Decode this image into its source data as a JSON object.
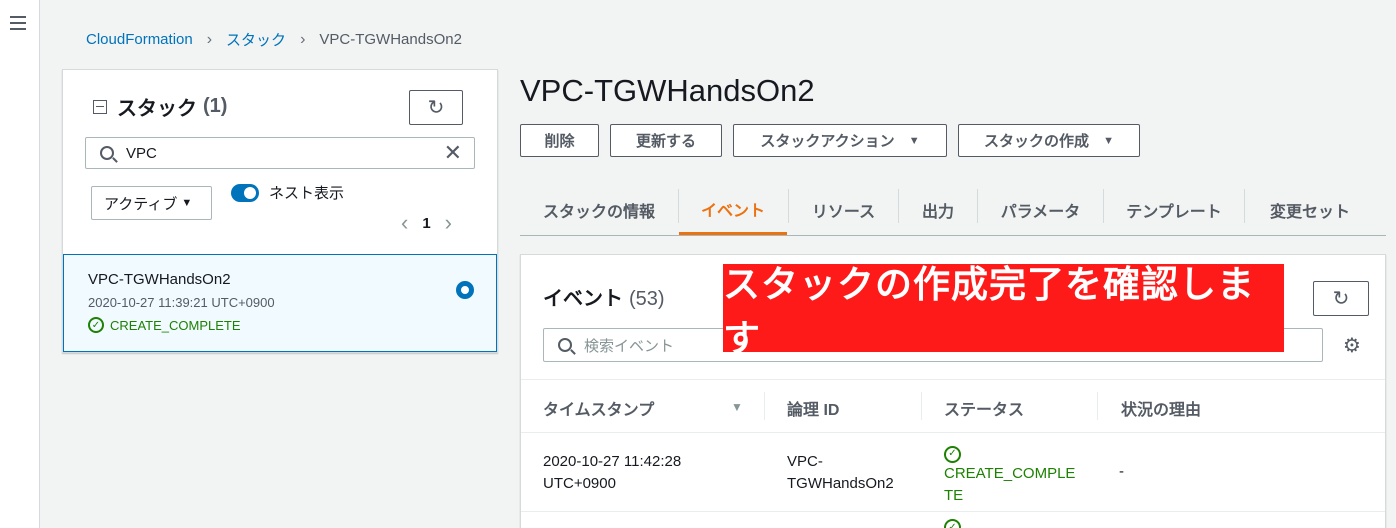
{
  "breadcrumb": {
    "root": "CloudFormation",
    "mid": "スタック",
    "current": "VPC-TGWHandsOn2"
  },
  "stack_panel": {
    "title": "スタック",
    "count": "(1)",
    "search_value": "VPC",
    "filter_label": "アクティブ",
    "nested_label": "ネスト表示",
    "nested_enabled": true,
    "page": "1",
    "item": {
      "name": "VPC-TGWHandsOn2",
      "time": "2020-10-27 11:39:21 UTC+0900",
      "status": "CREATE_COMPLETE"
    }
  },
  "main": {
    "title": "VPC-TGWHandsOn2",
    "actions": {
      "delete": "削除",
      "update": "更新する",
      "stack_actions": "スタックアクション",
      "create_stack": "スタックの作成"
    },
    "tabs": [
      "スタックの情報",
      "イベント",
      "リソース",
      "出力",
      "パラメータ",
      "テンプレート",
      "変更セット"
    ],
    "active_tab": 1,
    "events": {
      "title": "イベント",
      "count": "(53)",
      "search_placeholder": "検索イベント",
      "columns": [
        "タイムスタンプ",
        "論理 ID",
        "ステータス",
        "状況の理由"
      ],
      "rows": [
        {
          "time_line1": "2020-10-27 11:42:28",
          "time_line2": "UTC+0900",
          "id_line1": "VPC-",
          "id_line2": "TGWHandsOn2",
          "status_line1": "CREATE_COMPLE",
          "status_line2": "TE",
          "reason": "-"
        }
      ]
    }
  },
  "banner": "スタックの作成完了を確認します",
  "colors": {
    "accent": "#ec7211",
    "link": "#0073bb",
    "success": "#1d8102",
    "banner": "#ff1a1a"
  }
}
